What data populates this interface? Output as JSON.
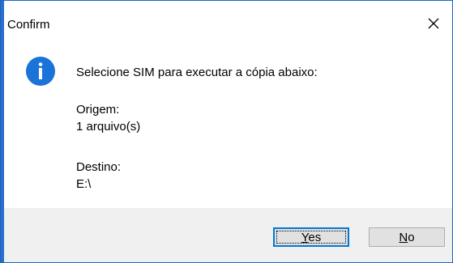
{
  "dialog": {
    "title": "Confirm",
    "close_icon": "close-icon",
    "icon": "info-icon",
    "message_lines": [
      "Selecione SIM para executar a cópia abaixo:",
      "Origem:",
      "1 arquivo(s)",
      "Destino:",
      "E:\\"
    ],
    "buttons": {
      "yes": {
        "mnemonic": "Y",
        "rest": "es"
      },
      "no": {
        "mnemonic": "N",
        "rest": "o"
      }
    },
    "colors": {
      "accent": "#0078d7",
      "icon_blue": "#1a73d6",
      "footer_bg": "#f0f0f0",
      "button_bg": "#e1e1e1"
    }
  }
}
